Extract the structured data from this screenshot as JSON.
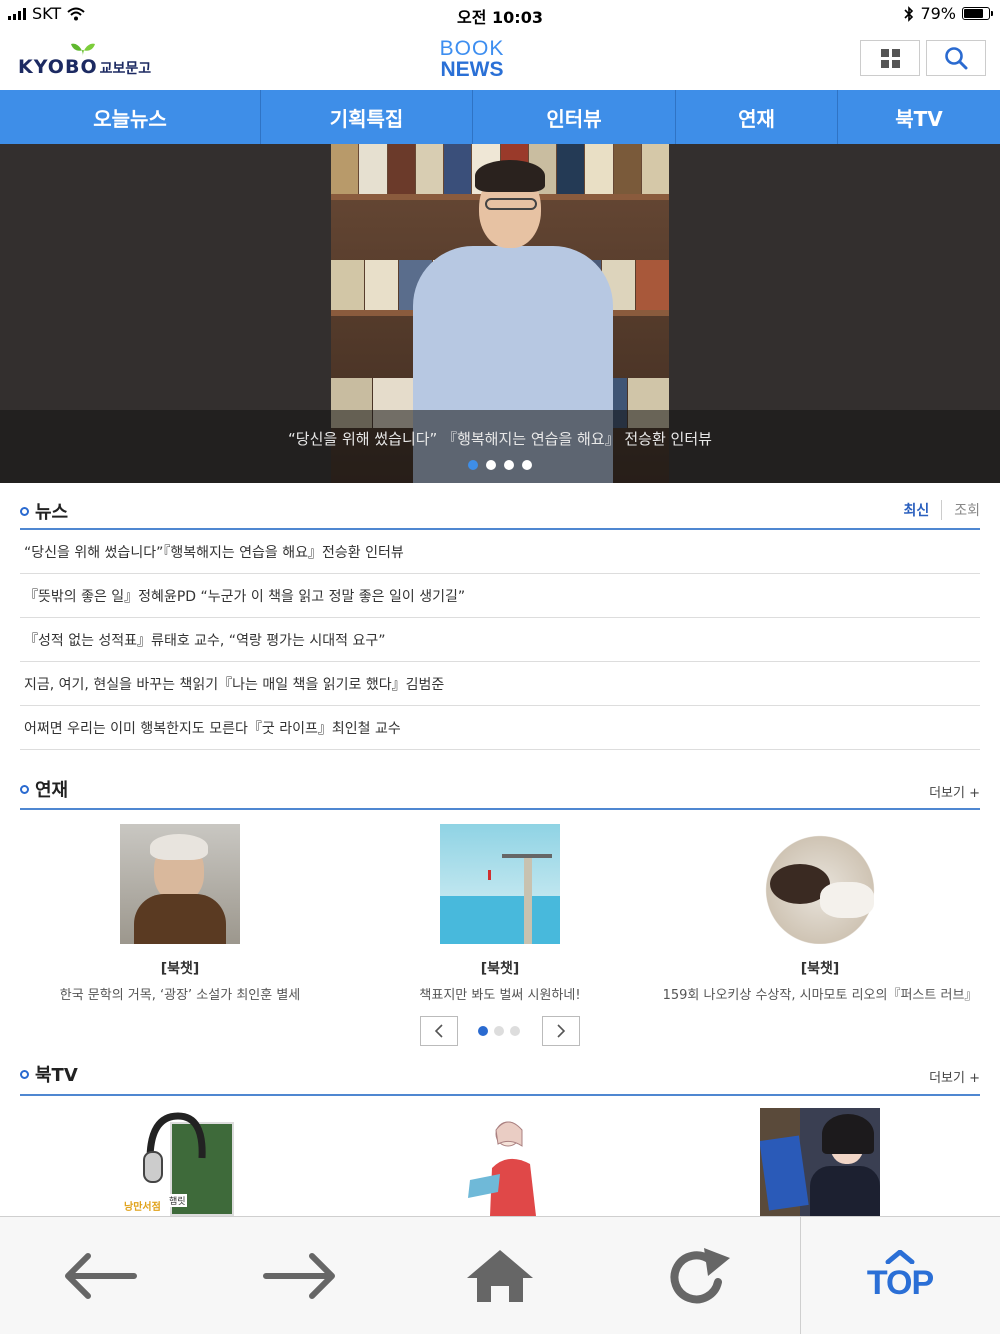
{
  "status_bar": {
    "carrier": "SKT",
    "time": "오전 10:03",
    "battery": "79%",
    "battery_level": 0.79
  },
  "header": {
    "kyobo_logo": "KYOBO",
    "kyobo_logo_kr": "교보문고",
    "booknews_logo_line1": "BOOK",
    "booknews_logo_line2": "NEWS"
  },
  "gnb": {
    "items": [
      "오늘뉴스",
      "기획특집",
      "인터뷰",
      "연재",
      "북TV"
    ]
  },
  "hero": {
    "caption": "“당신을 위해 썼습니다” 『행복해지는 연습을 해요』 전승환 인터뷰",
    "slide_count": 4,
    "active_slide": 1
  },
  "news": {
    "title": "뉴스",
    "sort_latest": "최신",
    "sort_views": "조회",
    "items": [
      "“당신을 위해 썼습니다”『행복해지는 연습을 해요』전승환 인터뷰",
      "『뜻밖의 좋은 일』정혜윤PD “누군가 이 책을 읽고 정말 좋은 일이 생기길”",
      "『성적 없는 성적표』류태호 교수, “역랑 평가는 시대적 요구”",
      "지금, 여기, 현실을 바꾸는 책읽기『나는 매일 책을 읽기로 했다』김범준",
      "어쩌면 우리는 이미 행복한지도 모른다『굿 라이프』최인철 교수"
    ]
  },
  "serial": {
    "title": "연재",
    "more": "더보기 +",
    "cards": [
      {
        "tag": "[북챗]",
        "desc": "한국 문학의 거목, ‘광장’ 소설가 최인훈 별세"
      },
      {
        "tag": "[북챗]",
        "desc": "책표지만 봐도 벌써 시원하네!"
      },
      {
        "tag": "[북챗]",
        "desc": "159회 나오키상 수상작, 시마모토 리오의『퍼스트 러브』"
      }
    ],
    "pager_active": 1,
    "pager_total": 3
  },
  "booktv": {
    "title": "북TV",
    "more": "더보기 +",
    "thumb1_text": "낭만서점",
    "thumb1_badge": "햄릿"
  },
  "toolbar": {
    "top_label": "TOP"
  },
  "colors": {
    "brand_blue": "#3e8ee8",
    "section_blue": "#2a6ad0"
  }
}
